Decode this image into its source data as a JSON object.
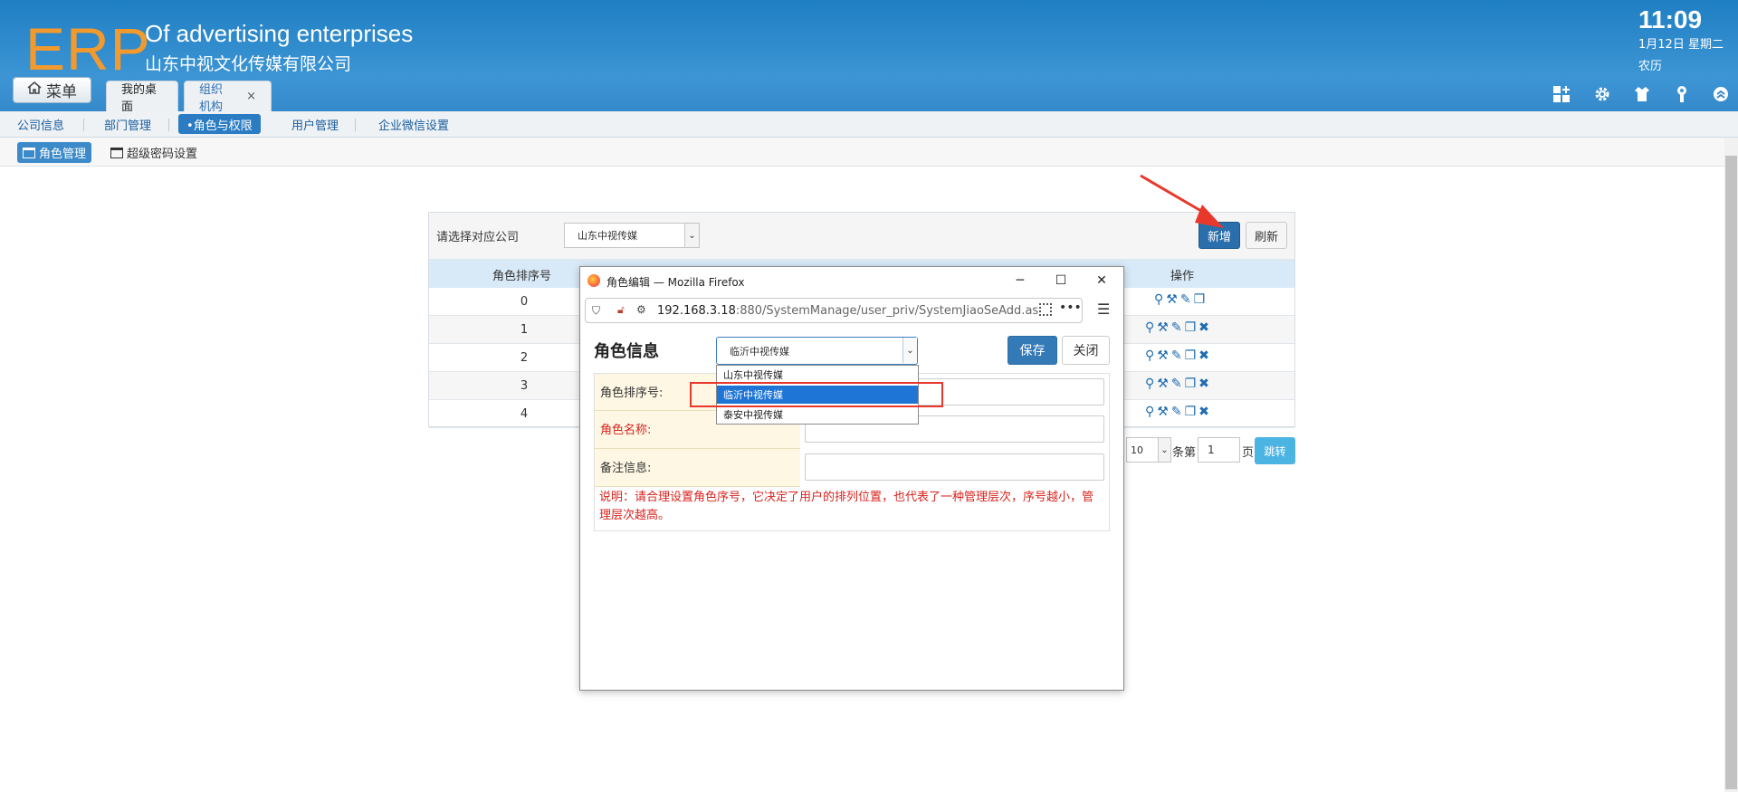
{
  "header": {
    "logo": "ERP",
    "tagline": "Of advertising enterprises",
    "company": "山东中视文化传媒有限公司",
    "time": "11:09",
    "date": "1月12日 星期二",
    "lunar": "农历",
    "menu_label": "菜单",
    "icons": [
      "add-widget-icon",
      "gear-icon",
      "shirt-icon",
      "key-icon",
      "collapse-icon"
    ]
  },
  "tabs": [
    {
      "label": "我的桌面"
    },
    {
      "label": "组织机构",
      "close": "×"
    }
  ],
  "subnav": [
    "公司信息",
    "部门管理",
    "•角色与权限",
    "用户管理",
    "企业微信设置"
  ],
  "nav3": [
    "角色管理",
    "超级密码设置"
  ],
  "panel": {
    "company_label": "请选择对应公司",
    "company_value": "山东中视传媒",
    "add_label": "新增",
    "refresh_label": "刷新",
    "col_sort": "角色排序号",
    "col_ops": "操作",
    "rows": [
      "0",
      "1",
      "2",
      "3",
      "4"
    ],
    "pager": {
      "size": "10",
      "items_text": "条第",
      "page": "1",
      "page_text": "页",
      "go_label": "跳转"
    }
  },
  "popup": {
    "title": "角色编辑 — Mozilla Firefox",
    "url_host": "192.168.3.18",
    "url_rest": ":880/SystemManage/user_priv/SystemJiaoSeAdd.as",
    "heading": "角色信息",
    "selected_company": "临沂中视传媒",
    "save_label": "保存",
    "close_label": "关闭",
    "dropdown_options": [
      "山东中视传媒",
      "临沂中视传媒",
      "泰安中视传媒"
    ],
    "fields": [
      {
        "label": "角色排序号:"
      },
      {
        "label": "角色名称:"
      },
      {
        "label": "备注信息:"
      }
    ],
    "note": "说明：请合理设置角色序号，它决定了用户的排列位置，也代表了一种管理层次，序号越小，管理层次越高。"
  },
  "colors": {
    "accent": "#2b7cc2",
    "logo": "#f39a2e",
    "highlight": "#e8382c",
    "required": "#d9231e"
  }
}
